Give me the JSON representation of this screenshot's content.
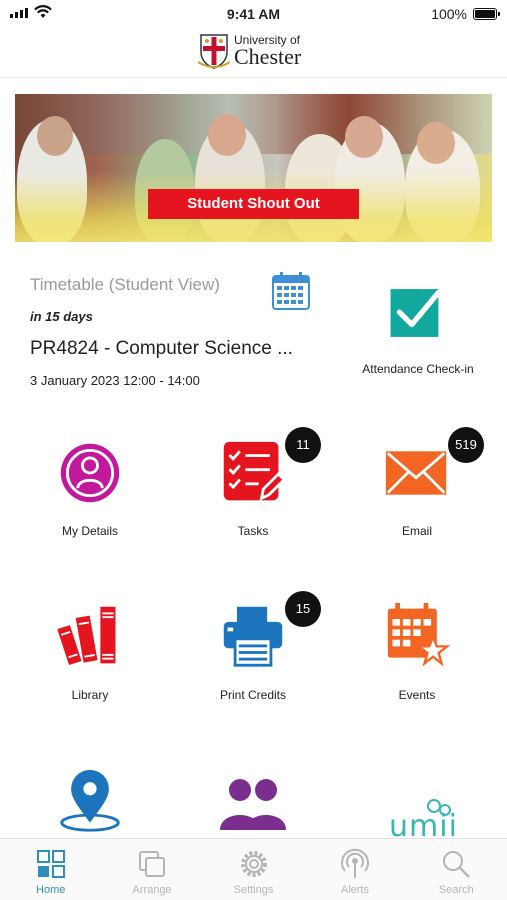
{
  "status": {
    "time": "9:41 AM",
    "battery": "100%"
  },
  "header": {
    "logo_line1": "University of",
    "logo_line2": "Chester"
  },
  "banner": {
    "button_label": "Student Shout Out"
  },
  "timetable": {
    "title": "Timetable (Student View)",
    "when": "in 15 days",
    "module": "PR4824 - Computer Science ...",
    "date": "3 January 2023 12:00 - 14:00"
  },
  "tiles": {
    "attendance": {
      "label": "Attendance Check-in"
    },
    "my_details": {
      "label": "My Details"
    },
    "tasks": {
      "label": "Tasks",
      "badge": "11"
    },
    "email": {
      "label": "Email",
      "badge": "519"
    },
    "library": {
      "label": "Library"
    },
    "print_credits": {
      "label": "Print Credits",
      "badge": "15"
    },
    "events": {
      "label": "Events"
    },
    "umii": {
      "logo_text": "umii"
    }
  },
  "tabbar": [
    {
      "label": "Home",
      "icon": "home-grid-icon",
      "active": true
    },
    {
      "label": "Arrange",
      "icon": "arrange-icon",
      "active": false
    },
    {
      "label": "Settings",
      "icon": "gear-icon",
      "active": false
    },
    {
      "label": "Alerts",
      "icon": "broadcast-icon",
      "active": false
    },
    {
      "label": "Search",
      "icon": "search-icon",
      "active": false
    }
  ],
  "colors": {
    "accent_teal": "#13a89e",
    "magenta": "#c2189b",
    "red": "#e4151f",
    "orange": "#f26522",
    "blue": "#1c75bc",
    "purple": "#7a2f8f",
    "active_tab": "#2f8fb5"
  }
}
